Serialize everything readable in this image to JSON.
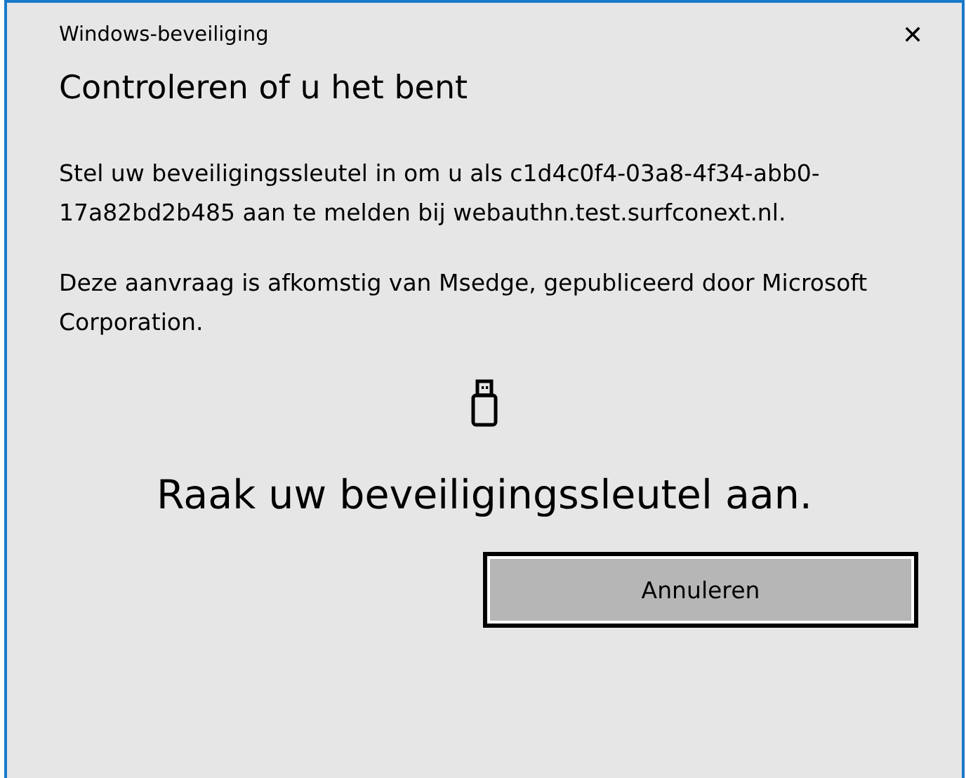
{
  "window": {
    "title": "Windows-beveiliging",
    "close": "✕"
  },
  "heading": "Controleren of u het bent",
  "paragraphs": [
    "Stel uw beveiligingssleutel in om u als c1d4c0f4-03a8-4f34-abb0-17a82bd2b485 aan te melden bij webauthn.test.surfconext.nl.",
    "Deze aanvraag is afkomstig van Msedge, gepubliceerd door Microsoft Corporation."
  ],
  "prompt": "Raak uw beveiligingssleutel aan.",
  "buttons": [
    {
      "label": "Annuleren",
      "focused": true
    }
  ]
}
